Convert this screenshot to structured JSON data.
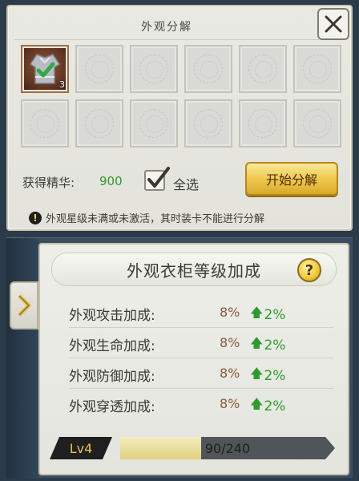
{
  "colors": {
    "panel_bg": "#e6e6df",
    "green_value": "#2f9a2f",
    "bonus_value": "#8a5a3a",
    "gold_button": "#f0c94e",
    "level_text": "#e9c44a"
  },
  "decompose_panel": {
    "title": "外观分解",
    "close_icon": "close-icon",
    "slots": [
      {
        "filled": true,
        "icon": "robe-item-icon",
        "checked": true,
        "count": "3"
      },
      {
        "filled": false
      },
      {
        "filled": false
      },
      {
        "filled": false
      },
      {
        "filled": false
      },
      {
        "filled": false
      },
      {
        "filled": false
      },
      {
        "filled": false
      },
      {
        "filled": false
      },
      {
        "filled": false
      },
      {
        "filled": false
      },
      {
        "filled": false
      }
    ],
    "essence_label": "获得精华:",
    "essence_value": "900",
    "select_all_label": "全选",
    "select_all_checked": true,
    "start_button_label": "开始分解",
    "warning_text": "外观星级未满或未激活，其时装卡不能进行分解"
  },
  "wardrobe_bonus": {
    "title": "外观衣柜等级加成",
    "help_icon": "?",
    "stats": [
      {
        "label": "外观攻击加成:",
        "value": "8%",
        "bonus": "2%"
      },
      {
        "label": "外观生命加成:",
        "value": "8%",
        "bonus": "2%"
      },
      {
        "label": "外观防御加成:",
        "value": "8%",
        "bonus": "2%"
      },
      {
        "label": "外观穿透加成:",
        "value": "8%",
        "bonus": "2%"
      }
    ],
    "level_label": "Lv4",
    "exp_text": "90/240",
    "exp_current": 90,
    "exp_max": 240
  }
}
